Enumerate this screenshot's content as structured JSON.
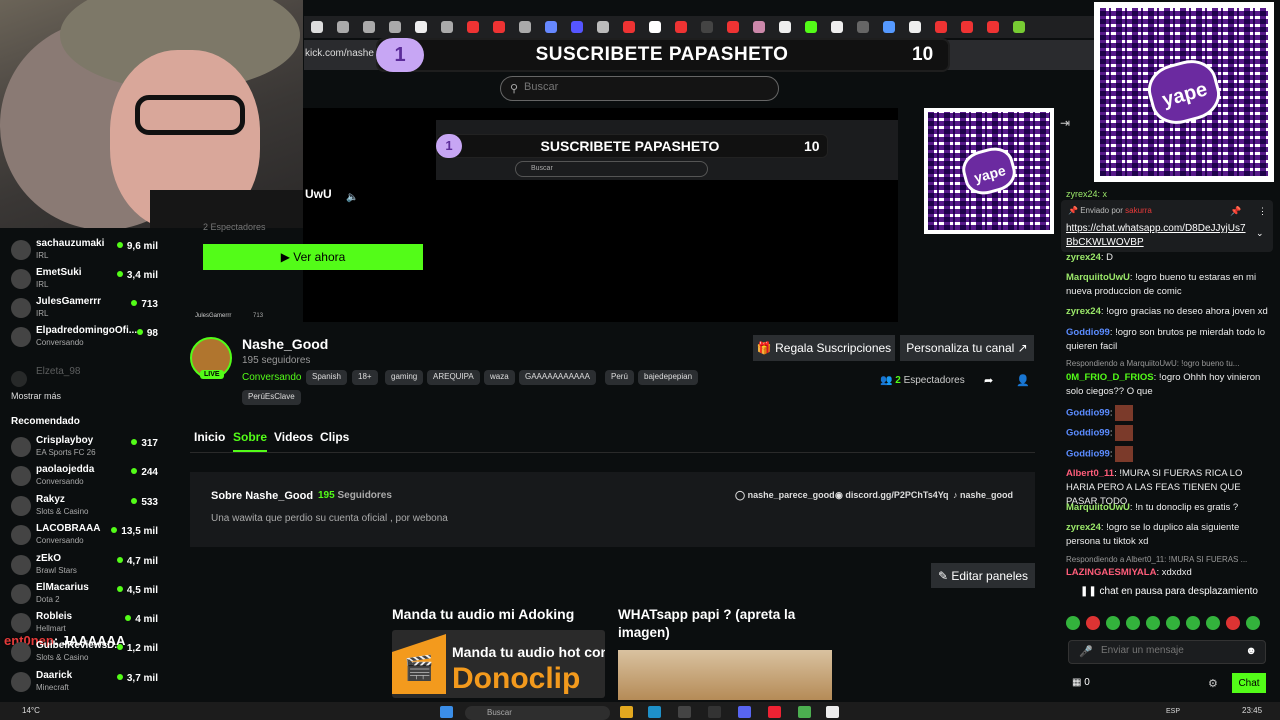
{
  "browser": {
    "address": "kick.com/nashe"
  },
  "banner": {
    "number": "1",
    "text": "SUSCRIBETE PAPASHETO",
    "count": "10"
  },
  "search": {
    "placeholder": "Buscar"
  },
  "preview": {
    "mini_number": "1",
    "mini_text": "SUSCRIBETE PAPASHETO",
    "mini_count": "10",
    "mini_search": "Buscar",
    "uwu": "UwU",
    "spectators": "2 Espectadores",
    "watch_now": "Ver ahora",
    "mini_user": "JulesGamerrr",
    "mini_user_count": "713"
  },
  "qr": {
    "brand": "yape"
  },
  "sidebar": {
    "following": [
      {
        "name": "sachauzumaki",
        "category": "IRL",
        "viewers": "9,6 mil"
      },
      {
        "name": "EmetSuki",
        "category": "IRL",
        "viewers": "3,4 mil"
      },
      {
        "name": "JulesGamerrr",
        "category": "IRL",
        "viewers": "713"
      },
      {
        "name": "ElpadredomingoOfi...",
        "category": "Conversando",
        "viewers": "98"
      }
    ],
    "offline": "Elzeta_98",
    "show_more": "Mostrar más",
    "recommended_title": "Recomendado",
    "recommended": [
      {
        "name": "Crisplayboy",
        "category": "EA Sports FC 26",
        "viewers": "317"
      },
      {
        "name": "paolaojedda",
        "category": "Conversando",
        "viewers": "244"
      },
      {
        "name": "Rakyz",
        "category": "Slots & Casino",
        "viewers": "533"
      },
      {
        "name": "LACOBRAAA",
        "category": "Conversando",
        "viewers": "13,5 mil"
      },
      {
        "name": "zEkO",
        "category": "Brawl Stars",
        "viewers": "4,7 mil"
      },
      {
        "name": "ElMacarius",
        "category": "Dota 2",
        "viewers": "4,5 mil"
      },
      {
        "name": "Robleis",
        "category": "Hellmart",
        "viewers": "4 mil"
      },
      {
        "name": "GuibelReviewsD...",
        "category": "Slots & Casino",
        "viewers": "1,2 mil"
      },
      {
        "name": "Daarick",
        "category": "Minecraft",
        "viewers": "3,7 mil"
      }
    ]
  },
  "overlay": {
    "user": "ent0nep",
    "text": ": JAAAAAA"
  },
  "channel": {
    "name": "Nashe_Good",
    "followers": "195 seguidores",
    "live": "LIVE",
    "category": "Conversando",
    "tags": [
      "Spanish",
      "18+",
      "gaming",
      "AREQUIPA",
      "waza",
      "GAAAAAAAAAAA",
      "Perú",
      "bajedepepian",
      "PerúEsClave"
    ],
    "gift_button": "Regala Suscripciones",
    "customize_button": "Personaliza tu canal",
    "spectators_num": "2",
    "spectators_label": "Espectadores"
  },
  "tabs": [
    "Inicio",
    "Sobre",
    "Videos",
    "Clips"
  ],
  "about": {
    "title": "Sobre Nashe_Good",
    "count": "195",
    "count_label": "Seguidores",
    "description": "Una wawita que perdio su cuenta oficial , por webona",
    "instagram": "nashe_parece_good",
    "discord": "discord.gg/P2PChTs4Yq",
    "tiktok": "nashe_good",
    "edit_panels": "Editar paneles"
  },
  "panels": [
    {
      "title": "Manda tu audio mi Adoking",
      "image_line1": "Manda tu audio hot con",
      "image_line2": "Donoclip"
    },
    {
      "title": "WHATsapp papi ? (apreta la imagen)"
    }
  ],
  "chat": {
    "pinned_by_label": "Enviado por",
    "pinned_by_user": "sakurra",
    "pinned_link": "https://chat.whatsapp.com/D8DeJJyjUs7BbCKWLWOVBP",
    "top_partial": "zyrex24: x",
    "messages": [
      {
        "user": "zyrex24",
        "color": "#9be86a",
        "text": "D"
      },
      {
        "user": "MarquiitoUwU",
        "color": "#9be86a",
        "text": "!ogro bueno tu estaras en mi nueva produccion de comic"
      },
      {
        "user": "zyrex24",
        "color": "#9be86a",
        "text": "!ogro gracias no deseo ahora joven xd"
      },
      {
        "user": "Goddio99",
        "color": "#5b8cff",
        "text": "!ogro son brutos pe mierdah todo lo quieren facil"
      },
      {
        "reply": "Respondiendo a MarquiitoUwU: !ogro bueno tu..."
      },
      {
        "user": "0M_FRIO_D_FRIOS",
        "color": "#53fc18",
        "text": "!ogro Ohhh hoy vinieron solo ciegos?? O que"
      },
      {
        "user": "Goddio99",
        "color": "#5b8cff",
        "text": "",
        "emote": true
      },
      {
        "user": "Goddio99",
        "color": "#5b8cff",
        "text": "",
        "emote": true
      },
      {
        "user": "Goddio99",
        "color": "#5b8cff",
        "text": "",
        "emote": true
      },
      {
        "user": "Albert0_11",
        "color": "#ff5d7a",
        "text": "!MURA SI FUERAS RICA LO HARIA PERO A LAS FEAS TIENEN QUE PASAR TODO"
      },
      {
        "user": "MarquiitoUwU",
        "color": "#9be86a",
        "text": "!n tu donoclip es gratis ?"
      },
      {
        "user": "zyrex24",
        "color": "#9be86a",
        "text": "!ogro se lo duplico ala siguiente persona tu tiktok xd"
      },
      {
        "reply": "Respondiendo a Albert0_11: !MURA SI FUERAS ..."
      },
      {
        "user": "LAZINGAESMIYALA",
        "color": "#ff5d7a",
        "text": "xdxdxd"
      }
    ],
    "paused": "chat en pausa para desplazamiento",
    "input_placeholder": "Enviar un mensaje",
    "count": "0",
    "chat_button": "Chat"
  },
  "taskbar": {
    "weather": "14°C",
    "search": "Buscar",
    "lang": "ESP",
    "time": "23:45"
  },
  "colors": {
    "accent": "#53fc18",
    "banner_badge": "#c7a6f4",
    "yape": "#57198a"
  }
}
